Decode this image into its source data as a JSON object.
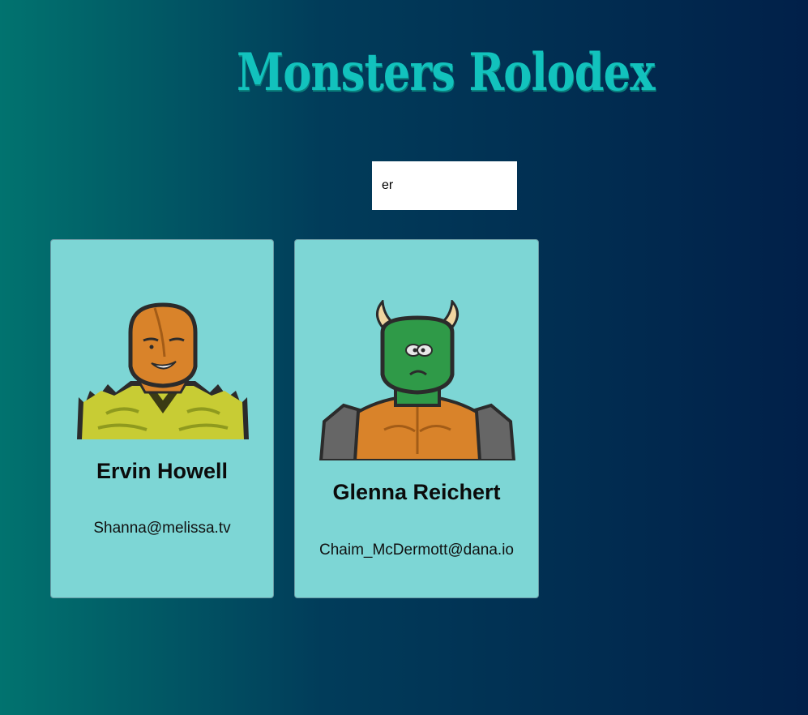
{
  "header": {
    "title": "Monsters Rolodex"
  },
  "search": {
    "value": "er"
  },
  "cards": [
    {
      "name": "Ervin Howell",
      "email": "Shanna@melissa.tv"
    },
    {
      "name": "Glenna Reichert",
      "email": "Chaim_McDermott@dana.io"
    }
  ]
}
